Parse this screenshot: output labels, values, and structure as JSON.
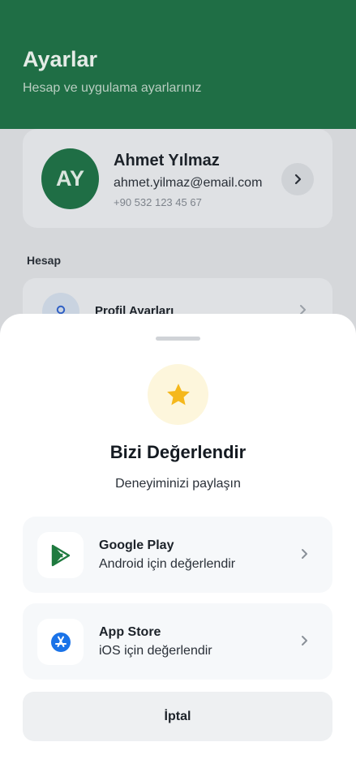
{
  "header": {
    "title": "Ayarlar",
    "subtitle": "Hesap ve uygulama ayarlarınız"
  },
  "profile": {
    "initials": "AY",
    "name": "Ahmet Yılmaz",
    "email": "ahmet.yilmaz@email.com",
    "phone": "+90 532 123 45 67"
  },
  "sections": {
    "account_label": "Hesap",
    "rows": [
      {
        "label": "Profil Ayarları",
        "icon": "user-icon"
      }
    ]
  },
  "sheet": {
    "icon": "star-icon",
    "title": "Bizi Değerlendir",
    "subtitle": "Deneyiminizi paylaşın",
    "options": [
      {
        "name": "Google Play",
        "description": "Android için değerlendir",
        "icon": "google-play-icon"
      },
      {
        "name": "App Store",
        "description": "iOS için değerlendir",
        "icon": "app-store-icon"
      }
    ],
    "cancel_label": "İptal"
  },
  "colors": {
    "brand_green": "#1f6e45",
    "star_yellow": "#f5b81c",
    "app_store_blue": "#1a73e8",
    "sheet_background": "#ffffff"
  }
}
